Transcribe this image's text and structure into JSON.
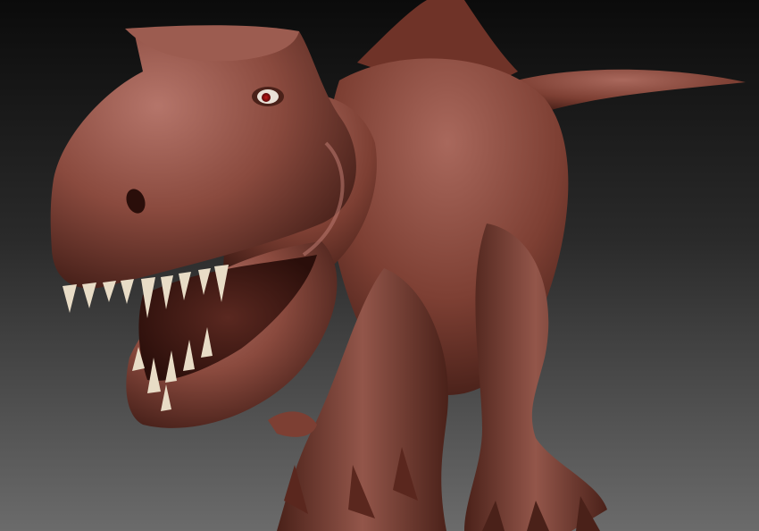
{
  "viewport": {
    "background_top": "#0b0b0b",
    "background_mid": "#2a2a2a",
    "background_bottom": "#6b6b6b"
  },
  "model": {
    "subject": "t-rex-sculpt",
    "material_color": "#8a4a3e",
    "material_shadow": "#3d1a14",
    "material_highlight": "#b5756a",
    "teeth_color": "#e8dcc6",
    "eye_color": "#c01818"
  }
}
